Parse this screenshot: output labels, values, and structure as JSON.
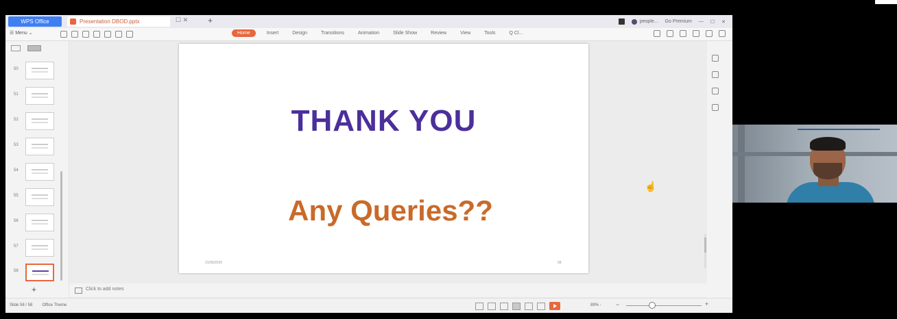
{
  "titlebar": {
    "app_tab": "WPS Office",
    "doc_tab": "Presentation DBOD.pptx",
    "tab_close": "☐ ✕",
    "new_tab": "+",
    "account": "people...",
    "cloud_status": "Go Premium"
  },
  "ribbon": {
    "menu_label": "☰ Menu ⌄",
    "tabs": [
      {
        "label": "Home",
        "active": true
      },
      {
        "label": "Insert",
        "active": false
      },
      {
        "label": "Design",
        "active": false
      },
      {
        "label": "Transitions",
        "active": false
      },
      {
        "label": "Animation",
        "active": false
      },
      {
        "label": "Slide Show",
        "active": false
      },
      {
        "label": "Review",
        "active": false
      },
      {
        "label": "View",
        "active": false
      },
      {
        "label": "Tools",
        "active": false
      },
      {
        "label": "Q Cl...",
        "active": false
      }
    ]
  },
  "sidebar": {
    "thumbnails": [
      {
        "num": "50"
      },
      {
        "num": "51"
      },
      {
        "num": "52"
      },
      {
        "num": "53"
      },
      {
        "num": "54"
      },
      {
        "num": "55"
      },
      {
        "num": "56"
      },
      {
        "num": "57"
      },
      {
        "num": "58"
      }
    ],
    "add_slide": "+"
  },
  "slide": {
    "title": "THANK YOU",
    "subtitle": "Any Queries??",
    "footer_date": "31/05/2020",
    "footer_num": "58"
  },
  "notes": {
    "placeholder": "Click to add notes"
  },
  "statusbar": {
    "slide_info": "Slide 58 / 58",
    "theme": "Office Theme",
    "zoom": "89% -"
  },
  "colors": {
    "accent": "#e8673d",
    "title": "#4b2f9a",
    "subtitle": "#c96a2a",
    "wps_blue": "#3f7ff2"
  }
}
